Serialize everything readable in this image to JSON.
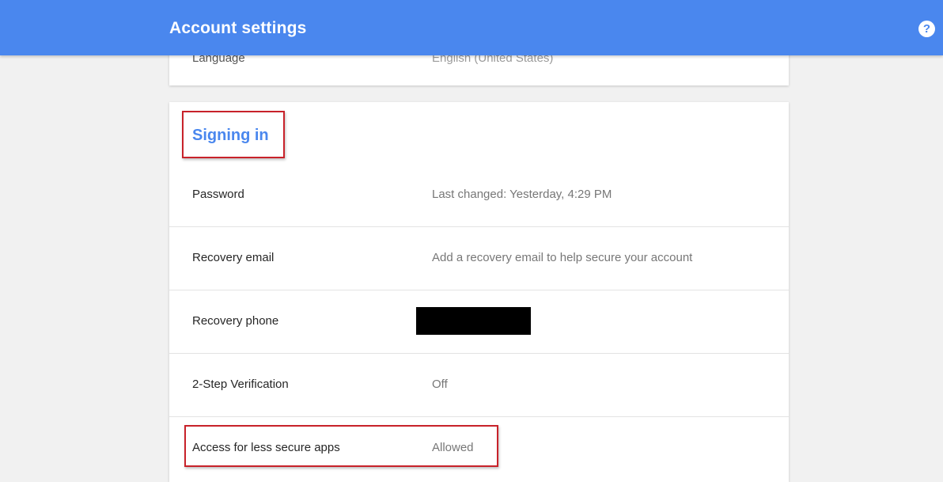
{
  "header": {
    "title": "Account settings",
    "help_icon": "?"
  },
  "language_row": {
    "label": "Language",
    "value": "English (United States)"
  },
  "signin": {
    "title": "Signing in",
    "rows": [
      {
        "label": "Password",
        "value": "Last changed: Yesterday, 4:29 PM"
      },
      {
        "label": "Recovery email",
        "value": "Add a recovery email to help secure your account"
      },
      {
        "label": "Recovery phone",
        "value": ""
      },
      {
        "label": "2-Step Verification",
        "value": "Off"
      },
      {
        "label": "Access for less secure apps",
        "value": "Allowed"
      }
    ]
  },
  "colors": {
    "header_bg": "#4a87ee",
    "highlight_red": "#c8222a",
    "section_title_blue": "#4a87ee"
  }
}
